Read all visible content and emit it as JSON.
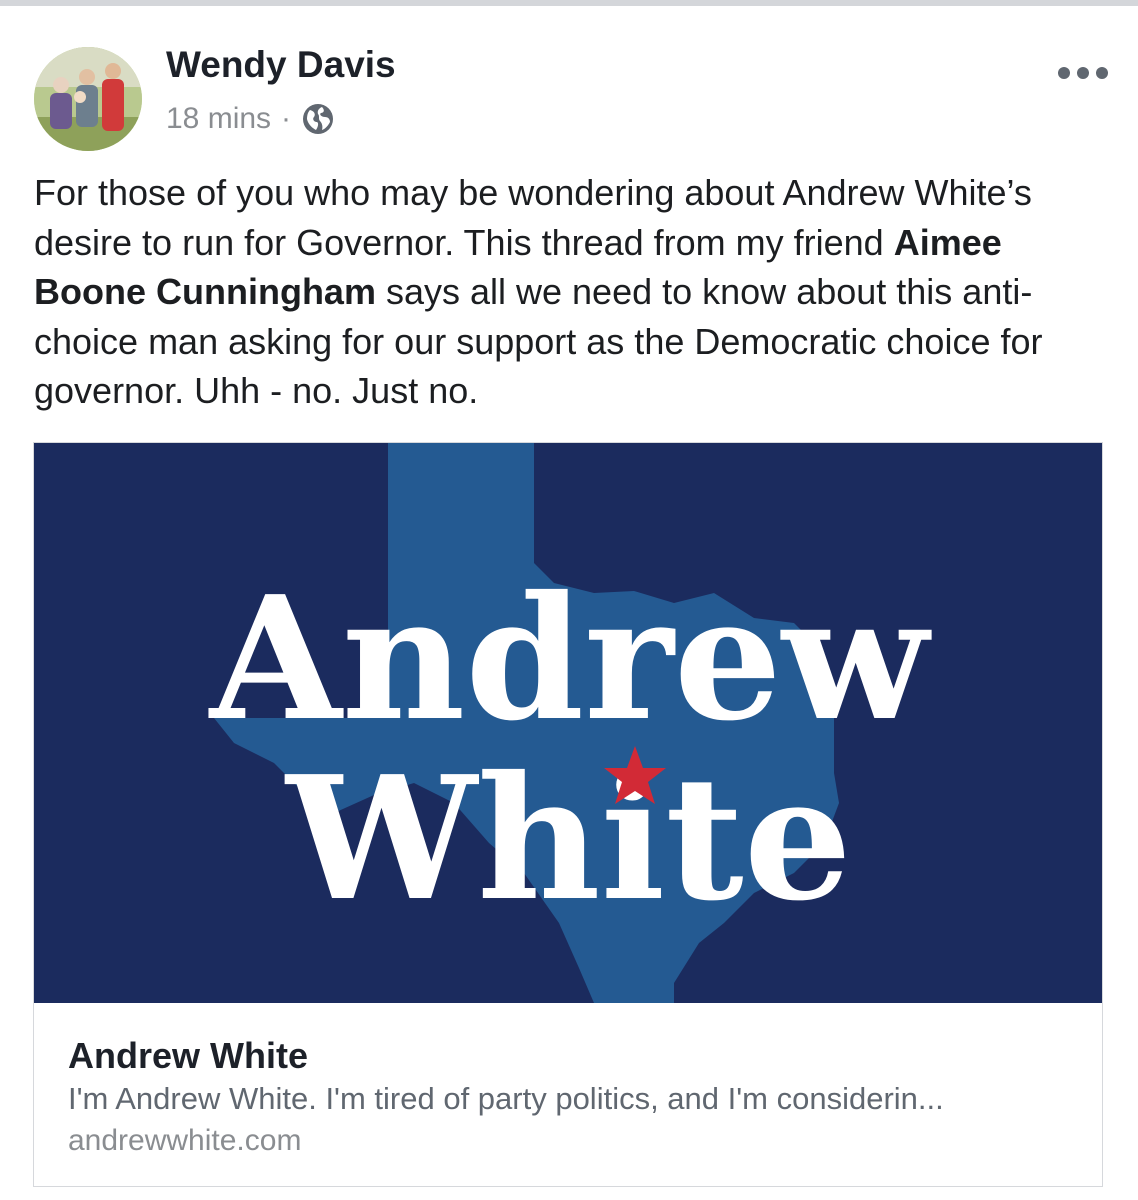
{
  "post": {
    "author": "Wendy Davis",
    "time": "18 mins",
    "separator": "·",
    "privacy_icon": "globe-icon",
    "text_part1": "For those of you who may be wondering about Andrew White’s desire to run for Governor. This thread from my friend ",
    "mention": "Aimee Boone Cunningham",
    "text_part2": " says all we need to know about this anti-choice man asking for our support as the Democratic choice for governor. Uhh - no. Just no."
  },
  "link": {
    "image_text_line1": "Andrew",
    "image_text_line2": "White",
    "title": "Andrew White",
    "description": "I'm Andrew White. I'm tired of party politics, and I'm considerin...",
    "domain": "andrewwhite.com"
  },
  "colors": {
    "banner_navy": "#1b2b5e",
    "texas_blue": "#245a92",
    "star_red": "#d22a36",
    "meta_gray": "#8a8d91"
  }
}
